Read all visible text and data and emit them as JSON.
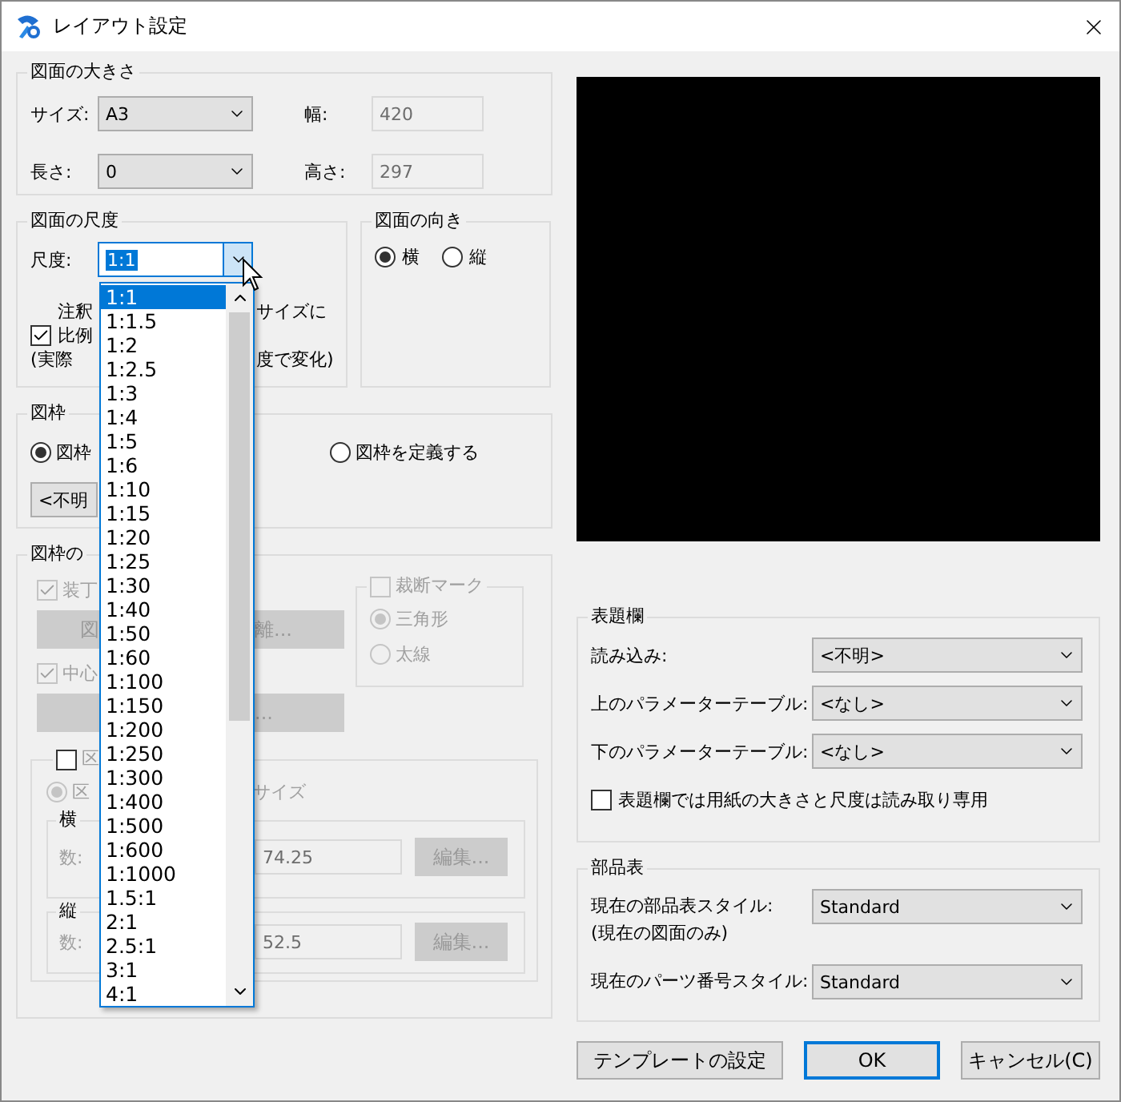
{
  "window": {
    "title": "レイアウト設定"
  },
  "paper_size": {
    "legend": "図面の大きさ",
    "fields": [
      {
        "label": "サイズ:",
        "kind": "combo",
        "value": "A3"
      },
      {
        "label": "幅:",
        "kind": "readonly",
        "value": "420"
      },
      {
        "label": "長さ:",
        "kind": "combo",
        "value": "0"
      },
      {
        "label": "高さ:",
        "kind": "readonly",
        "value": "297"
      }
    ]
  },
  "scale": {
    "legend": "図面の尺度",
    "label": "尺度:",
    "value": "1:1",
    "expanded": true,
    "annotation": {
      "checked": true,
      "lines": [
        {
          "left": "注釈",
          "right": "サイズに"
        },
        {
          "left": "比例"
        },
        {
          "left": "(実際",
          "right": "度で変化)"
        }
      ]
    },
    "options": [
      {
        "label": "1:1",
        "selected": true
      },
      {
        "label": "1:1.5",
        "selected": false
      },
      {
        "label": "1:2",
        "selected": false
      },
      {
        "label": "1:2.5",
        "selected": false
      },
      {
        "label": "1:3",
        "selected": false
      },
      {
        "label": "1:4",
        "selected": false
      },
      {
        "label": "1:5",
        "selected": false
      },
      {
        "label": "1:6",
        "selected": false
      },
      {
        "label": "1:10",
        "selected": false
      },
      {
        "label": "1:15",
        "selected": false
      },
      {
        "label": "1:20",
        "selected": false
      },
      {
        "label": "1:25",
        "selected": false
      },
      {
        "label": "1:30",
        "selected": false
      },
      {
        "label": "1:40",
        "selected": false
      },
      {
        "label": "1:50",
        "selected": false
      },
      {
        "label": "1:60",
        "selected": false
      },
      {
        "label": "1:100",
        "selected": false
      },
      {
        "label": "1:150",
        "selected": false
      },
      {
        "label": "1:200",
        "selected": false
      },
      {
        "label": "1:250",
        "selected": false
      },
      {
        "label": "1:300",
        "selected": false
      },
      {
        "label": "1:400",
        "selected": false
      },
      {
        "label": "1:500",
        "selected": false
      },
      {
        "label": "1:600",
        "selected": false
      },
      {
        "label": "1:1000",
        "selected": false
      },
      {
        "label": "1.5:1",
        "selected": false
      },
      {
        "label": "2:1",
        "selected": false
      },
      {
        "label": "2.5:1",
        "selected": false
      },
      {
        "label": "3:1",
        "selected": false
      },
      {
        "label": "4:1",
        "selected": false
      }
    ]
  },
  "orientation": {
    "legend": "図面の向き",
    "options": [
      {
        "label": "横",
        "selected": true
      },
      {
        "label": "縦",
        "selected": false
      }
    ]
  },
  "frame": {
    "legend": "図枠",
    "options": [
      {
        "label": "図枠",
        "selected": true
      },
      {
        "label": "図枠を定義する",
        "selected": false
      }
    ],
    "combo": "<不明"
  },
  "frame_options": {
    "legend": "図枠の",
    "disabled": true,
    "checks": [
      {
        "label": "装丁",
        "checked": true,
        "button": {
          "left": "図",
          "right": "離..."
        }
      },
      {
        "label": "中心",
        "checked": true,
        "button": {
          "right": "..."
        }
      }
    ],
    "trim": {
      "label": "裁断マーク",
      "checked": false,
      "options": [
        {
          "label": "三角形",
          "selected": true
        },
        {
          "label": "太線",
          "selected": false
        }
      ]
    },
    "division": {
      "label": "区",
      "checked": false,
      "radio": {
        "label": "区",
        "right": "サイズ",
        "selected": true
      },
      "rows": [
        {
          "legend": "横",
          "label": "数:",
          "value": "74.25",
          "button": "編集..."
        },
        {
          "legend": "縦",
          "label": "数:",
          "value": "52.5",
          "button": "編集..."
        }
      ]
    }
  },
  "title_block": {
    "legend": "表題欄",
    "rows": [
      {
        "label": "読み込み:",
        "value": "<不明>"
      },
      {
        "label": "上のパラメーターテーブル:",
        "value": "<なし>"
      },
      {
        "label": "下のパラメーターテーブル:",
        "value": "<なし>"
      }
    ],
    "readonly": {
      "label": "表題欄では用紙の大きさと尺度は読み取り専用",
      "checked": false
    }
  },
  "parts_list": {
    "legend": "部品表",
    "rows": [
      {
        "label": "現在の部品表スタイル:",
        "sublabel": "(現在の図面のみ)",
        "value": "Standard"
      },
      {
        "label": "現在のパーツ番号スタイル:",
        "value": "Standard"
      }
    ]
  },
  "buttons": [
    {
      "label": "テンプレートの設定",
      "default": false
    },
    {
      "label": "OK",
      "default": true
    },
    {
      "label": "キャンセル(C)",
      "default": false
    }
  ]
}
